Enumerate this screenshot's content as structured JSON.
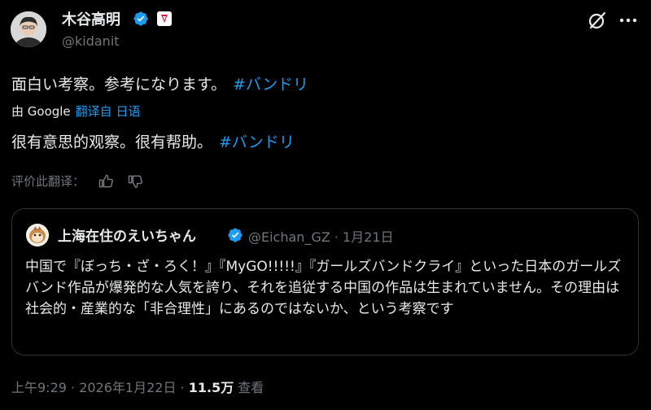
{
  "author": {
    "name": "木谷高明",
    "handle": "@kidanit"
  },
  "post": {
    "text": "面白い考察。参考になります。",
    "hashtag": "#バンドリ"
  },
  "translation": {
    "by_label": "由 Google",
    "from_label": "翻译自 日语",
    "text": "很有意思的观察。很有帮助。",
    "hashtag": "#バンドリ",
    "rate_label": "评价此翻译："
  },
  "quote": {
    "name": "上海在住のえいちゃん",
    "handle_date": "@Eichan_GZ · 1月21日",
    "body": "中国で『ぼっち・ざ・ろく！』『MyGO!!!!!』『ガールズバンドクライ』といった日本のガールズバンド作品が爆発的な人気を誇り、それを追従する中国の作品は生まれていません。その理由は社会的・産業的な「非合理性」にあるのではないか、という考察です"
  },
  "meta": {
    "time_date": "上午9:29 · 2026年1月22日 · ",
    "views_count": "11.5万",
    "views_label": "查看"
  },
  "icons": {
    "verified": "verified-check-icon",
    "affiliate": "affiliate-badge-icon",
    "grok": "grok-icon",
    "more": "more-icon",
    "thumb_up": "thumb-up-icon",
    "thumb_down": "thumb-down-icon"
  },
  "colors": {
    "background": "#000000",
    "text": "#e7e9ea",
    "secondary": "#71767b",
    "link": "#1d9bf0",
    "border": "#2f3336"
  }
}
